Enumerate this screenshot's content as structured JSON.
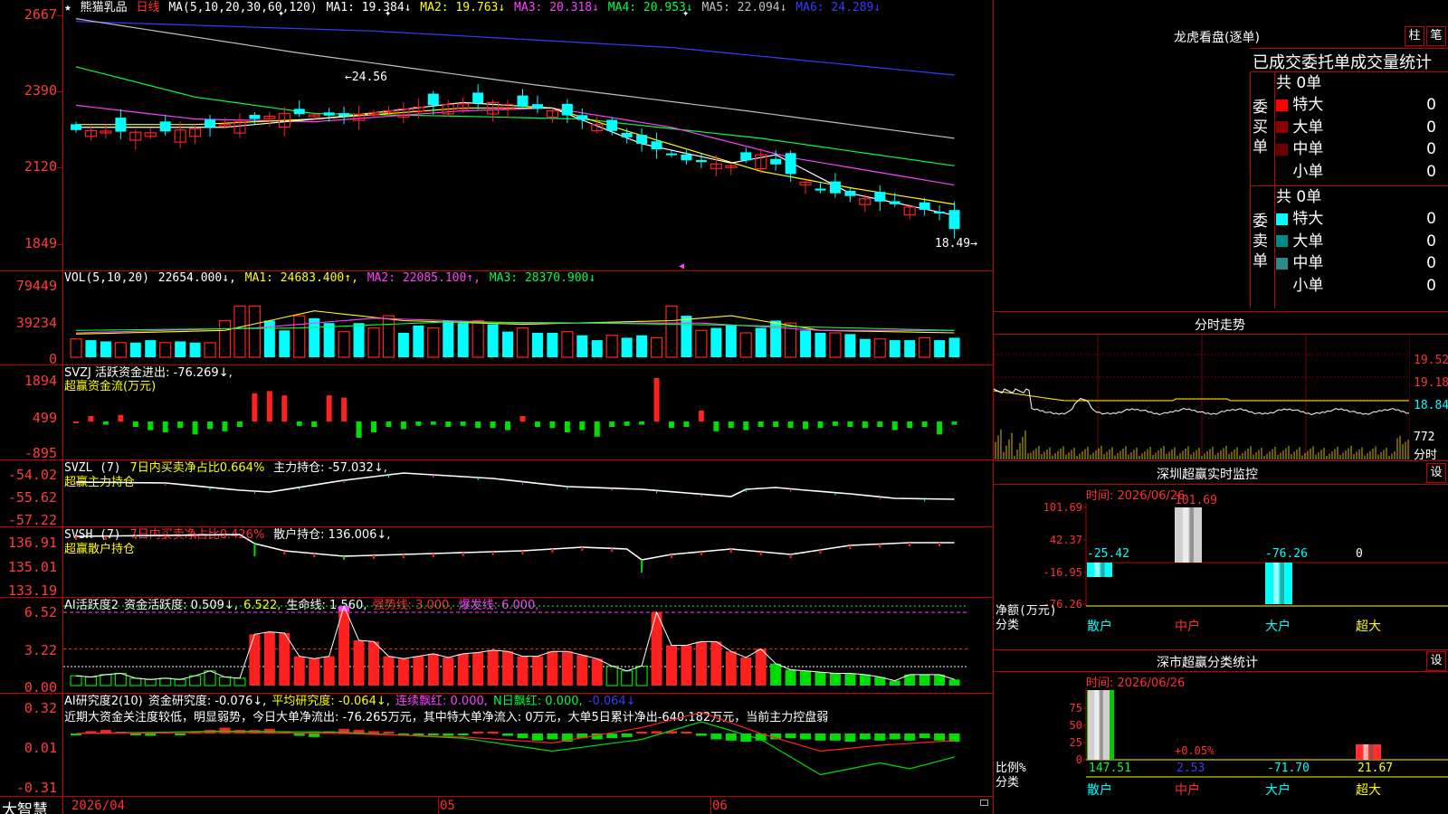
{
  "stock": {
    "star": "★",
    "name": "熊猫乳品",
    "period": "日线",
    "ma_def": "MA(5,10,20,30,60,120)",
    "ma": [
      {
        "label": "MA1:",
        "value": "19.384↓",
        "color": "#ffffff"
      },
      {
        "label": "MA2:",
        "value": "19.763↓",
        "color": "#ffff00"
      },
      {
        "label": "MA3:",
        "value": "20.318↓",
        "color": "#ff40ff"
      },
      {
        "label": "MA4:",
        "value": "20.953↓",
        "color": "#00ff40"
      },
      {
        "label": "MA5:",
        "value": "22.094↓",
        "color": "#c0c0c0"
      },
      {
        "label": "MA6:",
        "value": "24.289↓",
        "color": "#3a3aff"
      }
    ],
    "high_mark": "24.56",
    "low_mark": "18.49"
  },
  "price_axis": [
    "2667",
    "2390",
    "2120",
    "1849"
  ],
  "vol": {
    "title": "VOL(5,10,20)",
    "value": "22654.000↓,",
    "ma1": "MA1: 24683.400↑,",
    "ma2": "MA2: 22085.100↑,",
    "ma3": "MA3: 28370.900↓",
    "axis": [
      "79449",
      "39234",
      "0"
    ]
  },
  "svzj": {
    "line1": "SVZJ  活跃资金进出: -76.269↓,",
    "line2": "超赢资金流(万元)",
    "axis": [
      "1894",
      "499",
      "-895"
    ]
  },
  "svzl": {
    "name": "SVZL (7)",
    "desc": "7日内买卖净占比0.664%",
    "value": "主力持仓: -57.032↓,",
    "line2": "超赢主力持仓",
    "axis": [
      "-54.02",
      "-55.62",
      "-57.22"
    ]
  },
  "svsh": {
    "name": "SVSH (7)",
    "desc": "7日内买卖净占比0.426%",
    "value": "散户持仓: 136.006↓,",
    "line2": "超赢散户持仓",
    "axis": [
      "136.91",
      "135.01",
      "133.19"
    ]
  },
  "ai_active": {
    "name": "AI活跃度2",
    "value1": "资金活跃度: 0.509↓,",
    "value2": "6.522,",
    "value3": "生命线: 1.560,",
    "value4": "强势线: 3.000,",
    "value5": "爆发线: 6.000,",
    "axis": [
      "6.52",
      "3.22",
      "0.00"
    ]
  },
  "ai_research": {
    "name": "AI研究度2(10)",
    "value1": "资金研究度: -0.076↓,",
    "value2": "平均研究度: -0.064↓,",
    "value3": "连续飘红: 0.000,",
    "value4": "N日飘红: 0.000,",
    "value5": "-0.064↓",
    "comment": "近期大资金关注度较低，明显弱势，今日大单净流出: -76.265万元，其中特大单净流入: 0万元，大单5日累计净出-640.182万元，当前主力控盘弱",
    "axis": [
      "0.32",
      "0.01",
      "-0.31"
    ]
  },
  "bottom": {
    "brand": "大智慧",
    "date_start": "2026/04",
    "month1": "05",
    "month2": "06"
  },
  "right": {
    "dragon_title": "龙虎看盘(逐单)",
    "btn1": "柱",
    "btn2": "笔",
    "section_title": "已成交委托单成交量统计",
    "buy_label": "委买单",
    "sell_label": "委卖单",
    "buy_total": "共 0单",
    "sell_total": "共 0单",
    "buy_rows": [
      {
        "label": "特大",
        "value": "0",
        "pct": "0%",
        "color": "#ff0000"
      },
      {
        "label": "大单",
        "value": "0",
        "pct": "0%",
        "color": "#8b0000"
      },
      {
        "label": "中单",
        "value": "0",
        "pct": "0%",
        "color": "#6a0000"
      },
      {
        "label": "小单",
        "value": "0",
        "pct": "0%",
        "color": "#000000"
      }
    ],
    "sell_rows": [
      {
        "label": "特大",
        "value": "0",
        "pct": "0%",
        "color": "#00ffff"
      },
      {
        "label": "大单",
        "value": "0",
        "pct": "0%",
        "color": "#008b8b"
      },
      {
        "label": "中单",
        "value": "0",
        "pct": "0%",
        "color": "#2b8b8b"
      },
      {
        "label": "小单",
        "value": "0",
        "pct": "0%",
        "color": "#000000"
      }
    ],
    "minute_title": "分时走势",
    "minute_axis": [
      "19.52",
      "19.18",
      "18.84",
      "772",
      "分时"
    ],
    "monitor_title": "深圳超赢实时监控",
    "set_btn": "设",
    "monitor_time": "时间: 2026/06/26",
    "monitor_axis": [
      "101.69",
      "42.37",
      "-16.95",
      "-76.26"
    ],
    "monitor_values": [
      "-25.42",
      "101.69",
      "-76.26",
      "0"
    ],
    "monitor_ylabel": "净额(万元)",
    "monitor_xlabel": "分类",
    "categories": [
      "散户",
      "中户",
      "大户",
      "超大"
    ],
    "stat_title": "深市超赢分类统计",
    "stat_time": "时间: 2026/06/26",
    "stat_axis": [
      "75",
      "50",
      "25",
      "0"
    ],
    "stat_values": [
      "147.51",
      "2.53",
      "-71.70",
      "21.67"
    ],
    "stat_small": "+0.05%",
    "stat_ylabel": "比例%",
    "stat_xlabel": "分类"
  },
  "colors": {
    "up": "#ff2020",
    "down": "#00ffff",
    "border": "#c00000",
    "accent_yellow": "#ffff00"
  }
}
